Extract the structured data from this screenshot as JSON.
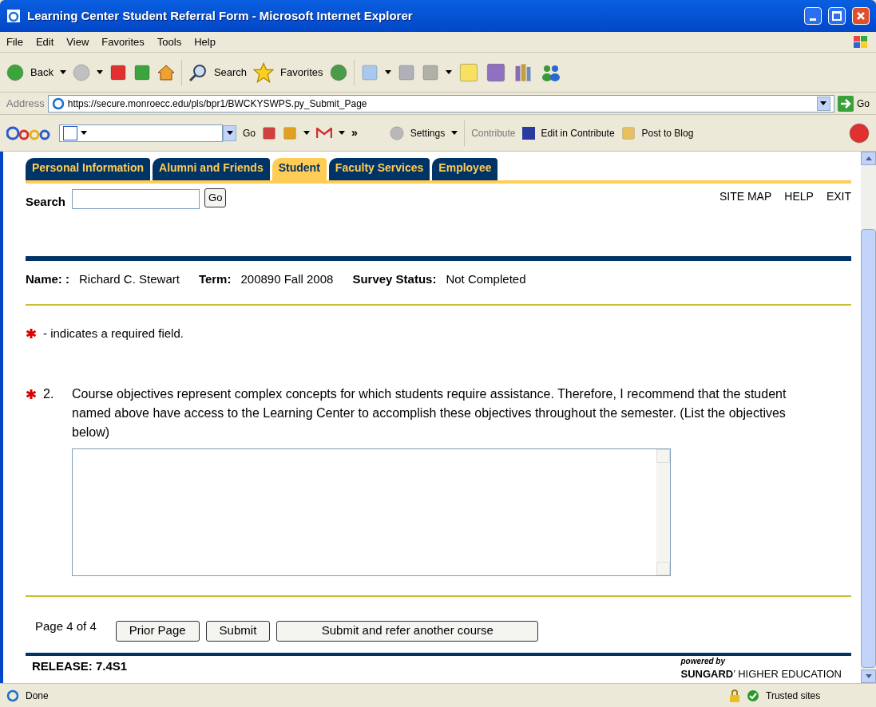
{
  "window": {
    "title": "Learning Center Student Referral Form - Microsoft Internet Explorer"
  },
  "menu": [
    "File",
    "Edit",
    "View",
    "Favorites",
    "Tools",
    "Help"
  ],
  "toolbar": {
    "back": "Back",
    "search": "Search",
    "favorites": "Favorites"
  },
  "address": {
    "label": "Address",
    "url": "https://secure.monroecc.edu/pls/bpr1/BWCKYSWPS.py_Submit_Page",
    "go": "Go"
  },
  "google_bar": {
    "go": "Go",
    "more": "»",
    "settings": "Settings",
    "contribute": "Contribute",
    "edit_in_contribute": "Edit in Contribute",
    "post_to_blog": "Post to Blog"
  },
  "tabs": [
    {
      "label": "Personal Information",
      "selected": false
    },
    {
      "label": "Alumni and Friends",
      "selected": false
    },
    {
      "label": "Student",
      "selected": true
    },
    {
      "label": "Faculty Services",
      "selected": false
    },
    {
      "label": "Employee",
      "selected": false
    }
  ],
  "search": {
    "label": "Search",
    "button": "Go"
  },
  "top_links": [
    "SITE MAP",
    "HELP",
    "EXIT"
  ],
  "info": [
    {
      "label": "Name: :",
      "value": "Richard C. Stewart"
    },
    {
      "label": "Term:",
      "value": "200890 Fall 2008"
    },
    {
      "label": "Survey Status:",
      "value": "Not Completed"
    }
  ],
  "required_note": "- indicates a required field.",
  "question": {
    "number": "2.",
    "text": "Course objectives represent complex concepts for which students require assistance. Therefore, I recommend that the student named above have access to the Learning Center to accomplish these objectives throughout the semester. (List the objectives below)",
    "required": true
  },
  "pager": {
    "text": "Page 4 of 4",
    "buttons": [
      "Prior Page",
      "Submit",
      "Submit and refer another course"
    ]
  },
  "release": "RELEASE: 7.4S1",
  "powered_by": {
    "line1": "powered by",
    "line2": "**SUNGARD**’ HIGHER EDUCATION"
  },
  "status_bar": {
    "text": "Done",
    "zone": "Trusted sites"
  }
}
